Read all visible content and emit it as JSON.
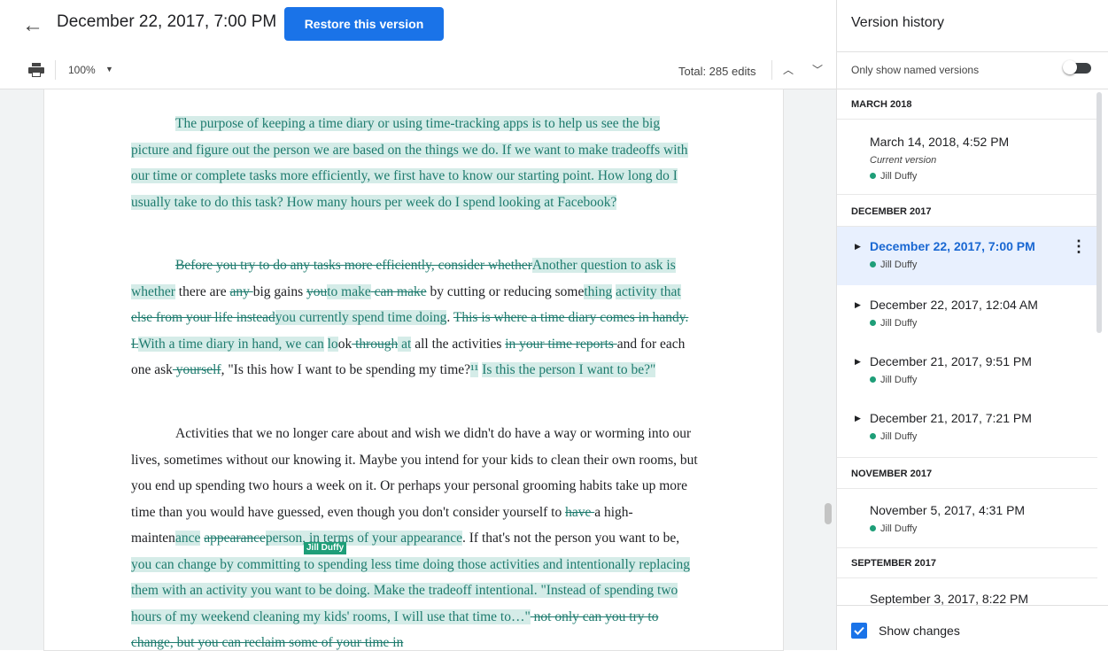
{
  "header": {
    "back_label": "←",
    "title": "December 22, 2017, 7:00 PM",
    "restore_label": "Restore this version"
  },
  "toolbar": {
    "zoom": "100%",
    "total_edits": "Total: 285 edits"
  },
  "doc": {
    "p1": [
      "The purpose of keeping a time diary or using time-tracking apps is to help us see the big picture and figure out the person we are based on the things we do. If we want to make tradeoffs with our time or complete tasks more efficiently, we first have to know our starting point. How long do I usually take to do this task? How many hours per week do I spend looking at Facebook?"
    ],
    "p2": {
      "d1": "Before you try to do any tasks more efficiently, consider whether",
      "i1": "Another question to ask is whether",
      "t1": " there are ",
      "d2": "any ",
      "t2": "big gains ",
      "d3": "you",
      "i2": "to make",
      "d4": " can make",
      "t3": " by cutting or reducing some",
      "i3": "thing",
      "t4": "",
      "i4": "activity that",
      "t5": " ",
      "d5": "else from your life instead",
      "i5": "you currently spend time doing",
      "t6": ". ",
      "d6": "This is where a time diary comes in handy. L",
      "i6": "With a time diary in hand, we can",
      "t7": " ",
      "i7": "lo",
      "t8": "ok",
      "d7": " through",
      "i8": " at",
      "t9": " all the activities ",
      "d8": "in your time reports ",
      "t10": "and for each one ask",
      "d9": " yourself",
      "t11": ", \"Is this how I want to be spending my time?",
      "i9": "¹¹",
      "t12": " ",
      "i10": "Is this the person I want to be?\""
    },
    "p3": {
      "t1": "Activities that we no longer care about and wish we didn't do have a way or worming into our lives, sometimes without our knowing it. Maybe you intend for your kids to clean their own rooms, but you end up spending two hours a week on it. Or perhaps your personal grooming habits take up more time than you would have guessed, even though you don't consider yourself to ",
      "d1": "have ",
      "t2": "a high-mainten",
      "i1": "ance",
      "t3": " ",
      "d2": "appearance",
      "i2": "person, in terms of your appearance",
      "t4": ". If that's not the person you want to be, ",
      "i3": "you can change by committing to spending less time doing those activities and intentionally replacing them with an activity you want to be doing. Make the tradeoff intentional. \"Instead of spending two hours of my weekend cleaning my kids' rooms, I will use that time to…\"",
      "d3": " not only can you try to change, but you can reclaim some of your time in"
    },
    "cursor_name": "Jill Duffy"
  },
  "panel": {
    "title": "Version history",
    "named_label": "Only show named versions",
    "show_changes": "Show changes",
    "months": [
      "MARCH 2018",
      "DECEMBER 2017",
      "NOVEMBER 2017",
      "SEPTEMBER 2017"
    ],
    "versions": [
      {
        "title": "March 14, 2018, 4:52 PM",
        "sub": "Current version",
        "author": "Jill Duffy"
      },
      {
        "title": "December 22, 2017, 7:00 PM",
        "author": "Jill Duffy"
      },
      {
        "title": "December 22, 2017, 12:04 AM",
        "author": "Jill Duffy"
      },
      {
        "title": "December 21, 2017, 9:51 PM",
        "author": "Jill Duffy"
      },
      {
        "title": "December 21, 2017, 7:21 PM",
        "author": "Jill Duffy"
      },
      {
        "title": "November 5, 2017, 4:31 PM",
        "author": "Jill Duffy"
      },
      {
        "title": "September 3, 2017, 8:22 PM"
      }
    ]
  },
  "colors": {
    "accent": "#1a73e8",
    "insert_bg": "#d5ece8",
    "insert_fg": "#1e7b6e",
    "author_dot": "#1e9e78"
  }
}
